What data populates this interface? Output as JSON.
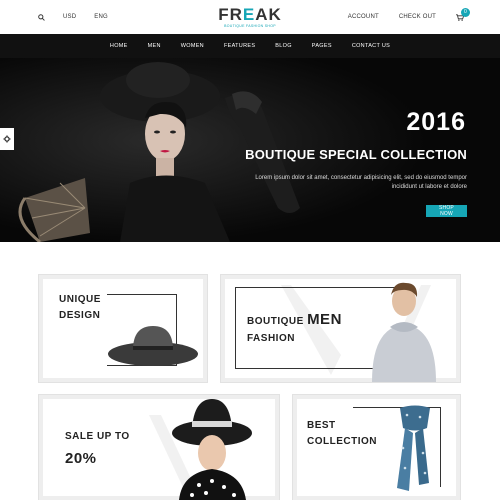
{
  "topbar": {
    "currency": "USD",
    "language": "ENG",
    "account": "ACCOUNT",
    "checkout": "CHECK OUT",
    "cart_count": "0"
  },
  "logo": {
    "name_part1": "FR",
    "name_accent": "E",
    "name_part2": "AK",
    "tagline": "BOUTIQUE FASHION SHOP"
  },
  "nav": {
    "items": [
      {
        "label": "HOME"
      },
      {
        "label": "MEN"
      },
      {
        "label": "WOMEN"
      },
      {
        "label": "FEATURES"
      },
      {
        "label": "BLOG"
      },
      {
        "label": "PAGES"
      },
      {
        "label": "CONTACT US"
      }
    ]
  },
  "hero": {
    "year": "2016",
    "subtitle": "BOUTIQUE SPECIAL COLLECTION",
    "description": "Lorem ipsum dolor sit amet, consectetur adipisicing elit, sed do eiusmod tempor incididunt ut labore et dolore",
    "button": "SHOP NOW"
  },
  "banners": {
    "unique": {
      "line1": "UNIQUE",
      "line2": "DESIGN"
    },
    "men": {
      "prefix": "BOUTIQUE",
      "highlight": "MEN",
      "line2": "FASHION"
    },
    "sale": {
      "line1": "SALE UP TO",
      "line2": "20%"
    },
    "best": {
      "line1": "BEST",
      "line2": "COLLECTION"
    }
  },
  "colors": {
    "accent": "#16a6b6",
    "nav_bg": "#111111",
    "hero_bg": "#070707"
  },
  "icons": [
    "search-icon",
    "cart-icon",
    "gear-icon"
  ]
}
